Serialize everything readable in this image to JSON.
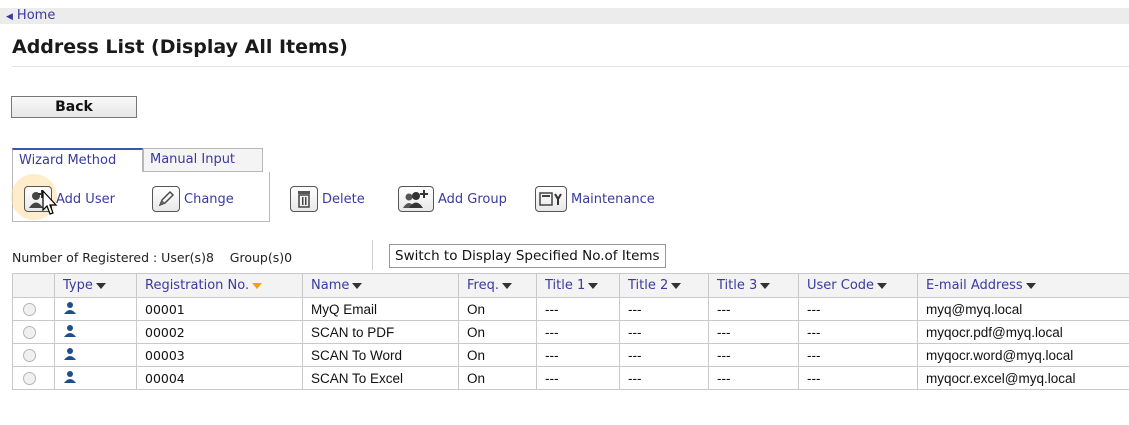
{
  "nav": {
    "home_label": "Home"
  },
  "page": {
    "title": "Address List (Display All Items)"
  },
  "back_label": "Back",
  "tabs": [
    {
      "label": "Wizard Method"
    },
    {
      "label": "Manual Input"
    }
  ],
  "toolbar": {
    "add_user": "Add User",
    "change": "Change",
    "delete": "Delete",
    "add_group": "Add Group",
    "maintenance": "Maintenance"
  },
  "summary": {
    "registered_text": "Number of Registered : User(s)8    Group(s)0"
  },
  "switch_label": "Switch to Display Specified No.of Items",
  "table": {
    "headers": [
      "Type",
      "Registration No.",
      "Name",
      "Freq.",
      "Title 1",
      "Title 2",
      "Title 3",
      "User Code",
      "E-mail Address"
    ],
    "rows": [
      {
        "reg": "00001",
        "name": "MyQ Email",
        "freq": "On",
        "t1": "---",
        "t2": "---",
        "t3": "---",
        "code": "---",
        "email": "myq@myq.local"
      },
      {
        "reg": "00002",
        "name": "SCAN to PDF",
        "freq": "On",
        "t1": "---",
        "t2": "---",
        "t3": "---",
        "code": "---",
        "email": "myqocr.pdf@myq.local"
      },
      {
        "reg": "00003",
        "name": "SCAN To Word",
        "freq": "On",
        "t1": "---",
        "t2": "---",
        "t3": "---",
        "code": "---",
        "email": "myqocr.word@myq.local"
      },
      {
        "reg": "00004",
        "name": "SCAN To Excel",
        "freq": "On",
        "t1": "---",
        "t2": "---",
        "t3": "---",
        "code": "---",
        "email": "myqocr.excel@myq.local"
      }
    ]
  },
  "colors": {
    "link": "#3a3aa0",
    "active_tab": "#3a55b0",
    "sort_active": "#f0a020",
    "user_icon": "#1f4e8c"
  }
}
